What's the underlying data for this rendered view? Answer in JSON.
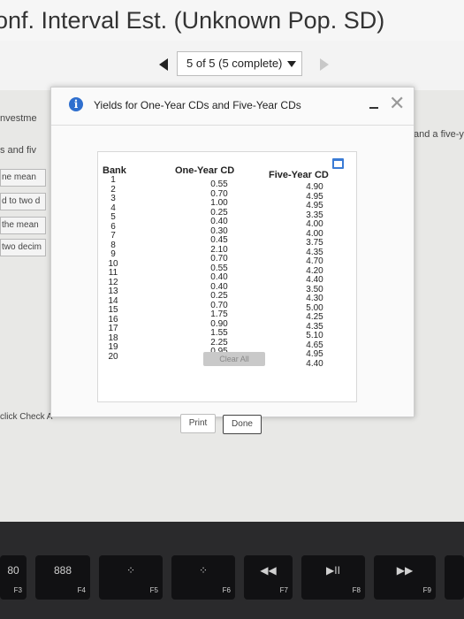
{
  "page_title": "onf. Interval Est. (Unknown Pop. SD)",
  "nav": {
    "progress": "5 of 5 (5 complete)"
  },
  "background_fragments": {
    "invest": "nvestme",
    "and_a_five": "and a five-y",
    "and_five": "s and fiv",
    "mean": "ne mean",
    "to_two": "d to two d",
    "the_mean": "the mean",
    "two_decim": "two decim",
    "click_check": "click Check A"
  },
  "dialog": {
    "title": "Yields for One-Year CDs and Five-Year CDs",
    "headers": {
      "bank": "Bank",
      "one_year": "One-Year CD",
      "five_year": "Five-Year CD"
    },
    "banks": [
      "1",
      "2",
      "3",
      "4",
      "5",
      "6",
      "7",
      "8",
      "9",
      "10",
      "11",
      "12",
      "13",
      "14",
      "15",
      "16",
      "17",
      "18",
      "19",
      "20"
    ],
    "one_year": [
      "0.55",
      "0.70",
      "1.00",
      "0.25",
      "0.40",
      "0.30",
      "0.45",
      "2.10",
      "0.70",
      "0.55",
      "0.40",
      "0.40",
      "0.25",
      "0.70",
      "1.75",
      "0.90",
      "1.55",
      "2.25",
      "0.95",
      "0.95"
    ],
    "five_year": [
      "4.90",
      "4.95",
      "4.95",
      "3.35",
      "4.00",
      "4.00",
      "3.75",
      "4.35",
      "4.70",
      "4.20",
      "4.40",
      "3.50",
      "4.30",
      "5.00",
      "4.25",
      "4.35",
      "5.10",
      "4.65",
      "4.95",
      "4.40"
    ],
    "print_label": "Print",
    "done_label": "Done"
  },
  "clear_all": "Clear All",
  "keyboard": {
    "f3": "F3",
    "f4": "F4",
    "f5": "F5",
    "f6": "F6",
    "f7": "F7",
    "f8": "F8",
    "f9": "F9",
    "f3_sym": "80",
    "f4_sym": "888",
    "f5_sym": "⁘",
    "f6_sym": "⁘",
    "f7_sym": "◀◀",
    "f8_sym": "▶II",
    "f9_sym": "▶▶"
  }
}
